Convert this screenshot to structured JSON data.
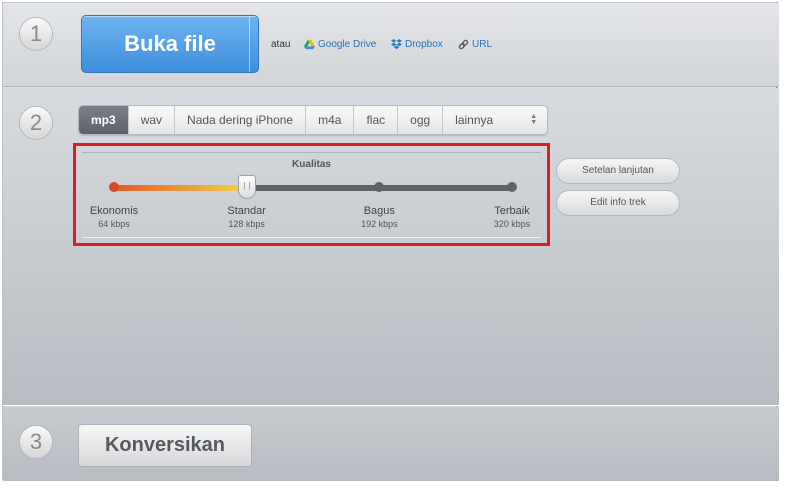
{
  "steps": {
    "one": "1",
    "two": "2",
    "three": "3"
  },
  "open": {
    "label": "Buka file",
    "or": "atau",
    "google_drive": "Google Drive",
    "dropbox": "Dropbox",
    "url": "URL"
  },
  "formats": {
    "tabs": [
      "mp3",
      "wav",
      "Nada dering iPhone",
      "m4a",
      "flac",
      "ogg",
      "lainnya"
    ],
    "selected": "mp3"
  },
  "quality": {
    "title": "Kualitas",
    "selected_level": "Standar",
    "levels": [
      {
        "name": "Ekonomis",
        "kbps": "64 kbps"
      },
      {
        "name": "Standar",
        "kbps": "128 kbps"
      },
      {
        "name": "Bagus",
        "kbps": "192 kbps"
      },
      {
        "name": "Terbaik",
        "kbps": "320 kbps"
      }
    ]
  },
  "options": {
    "advanced": "Setelan lanjutan",
    "edit_info": "Edit info trek"
  },
  "convert": {
    "label": "Konversikan"
  },
  "colors": {
    "primary_button": "#3e8fdc",
    "active_tab": "#5c616a",
    "highlight_border": "#e21a25",
    "link": "#2a6fba"
  },
  "icons": [
    "google-drive-icon",
    "dropbox-icon",
    "link-icon",
    "up-down-arrow-icon"
  ]
}
